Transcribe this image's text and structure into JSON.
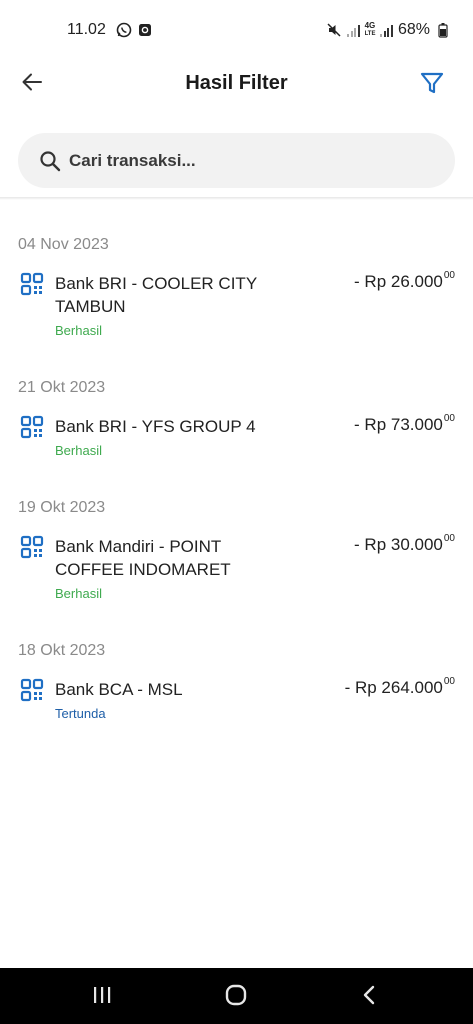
{
  "status_bar": {
    "time": "11.02",
    "battery": "68%",
    "network": [
      "4G",
      "LTE"
    ],
    "icons": [
      "whatsapp-icon",
      "app-notification-icon",
      "mute-icon",
      "signal-icon",
      "battery-icon"
    ]
  },
  "header": {
    "title": "Hasil Filter",
    "back_icon": "arrow-left-icon",
    "filter_icon": "filter-icon",
    "accent": "#1f6fc4"
  },
  "search": {
    "placeholder": "Cari transaksi..."
  },
  "groups": [
    {
      "date": "04 Nov 2023",
      "items": [
        {
          "name": "Bank BRI - COOLER CITY TAMBUN",
          "amount": "- Rp 26.000",
          "cents": "00",
          "status": "Berhasil"
        }
      ]
    },
    {
      "date": "21 Okt 2023",
      "items": [
        {
          "name": "Bank BRI - YFS GROUP 4",
          "amount": "- Rp 73.000",
          "cents": "00",
          "status": "Berhasil"
        }
      ]
    },
    {
      "date": "19 Okt 2023",
      "items": [
        {
          "name": "Bank Mandiri - POINT COFFEE INDOMARET",
          "amount": "- Rp 30.000",
          "cents": "00",
          "status": "Berhasil"
        }
      ]
    },
    {
      "date": "18 Okt 2023",
      "items": [
        {
          "name": "Bank BCA - MSL",
          "amount": "- Rp 264.000",
          "cents": "00",
          "status": "Tertunda"
        }
      ]
    }
  ],
  "colors": {
    "success": "#3faa4f",
    "pending": "#1f5fa8",
    "qr_icon": "#1f6fc4"
  },
  "nav_bar": {
    "icons": [
      "recent-apps-icon",
      "home-icon",
      "back-nav-icon"
    ]
  }
}
